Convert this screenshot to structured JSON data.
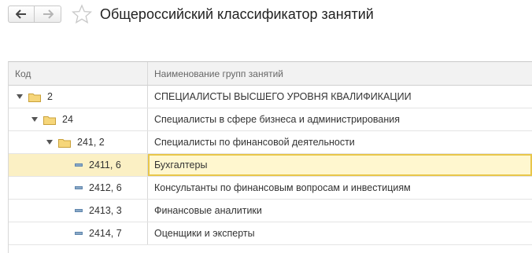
{
  "window": {
    "title": "Общероссийский классификатор занятий",
    "back_icon": "arrow-left-icon",
    "forward_icon": "arrow-right-icon",
    "favorite_icon": "star-icon"
  },
  "table": {
    "columns": [
      "Код",
      "Наименование групп занятий"
    ],
    "rows": [
      {
        "code": "2",
        "name": "СПЕЦИАЛИСТЫ ВЫСШЕГО УРОВНЯ КВАЛИФИКАЦИИ",
        "type": "group",
        "expanded": true,
        "level": 0
      },
      {
        "code": "24",
        "name": "Специалисты в сфере бизнеса и администрирования",
        "type": "group",
        "expanded": true,
        "level": 1
      },
      {
        "code": "241, 2",
        "name": "Специалисты по финансовой деятельности",
        "type": "group",
        "expanded": true,
        "level": 2
      },
      {
        "code": "2411, 6",
        "name": "Бухгалтеры",
        "type": "item",
        "selected": true,
        "level": 3
      },
      {
        "code": "2412, 6",
        "name": "Консультанты по финансовым вопросам и инвестициям",
        "type": "item",
        "level": 3
      },
      {
        "code": "2413, 3",
        "name": "Финансовые аналитики",
        "type": "item",
        "level": 3
      },
      {
        "code": "2414, 7",
        "name": "Оценщики и эксперты",
        "type": "item",
        "level": 3
      }
    ]
  },
  "colors": {
    "selected_row": "#fbf0c4",
    "selected_border": "#e8c64a",
    "folder": "#f0c860"
  }
}
